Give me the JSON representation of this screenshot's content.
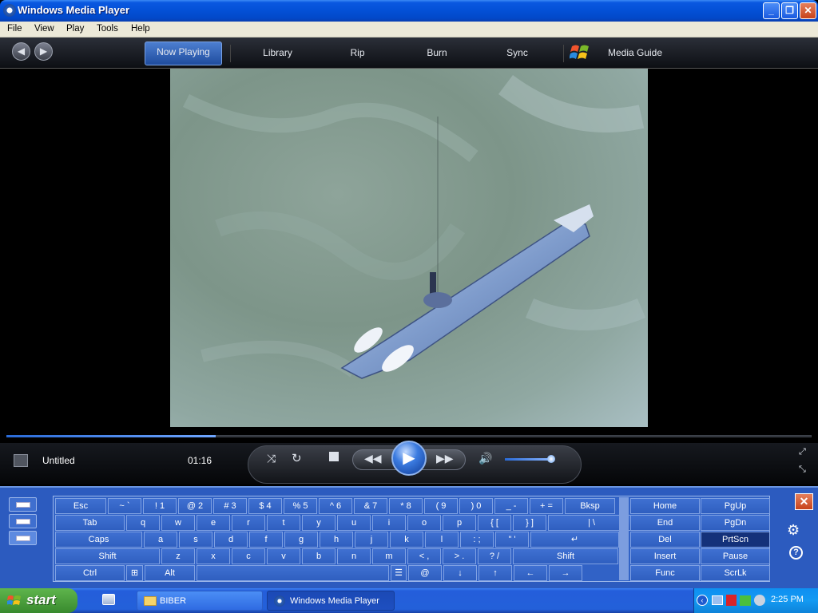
{
  "window": {
    "title": "Windows Media Player",
    "minimize_label": "_",
    "maximize_label": "❐",
    "close_label": "✕"
  },
  "menu": [
    "File",
    "View",
    "Play",
    "Tools",
    "Help"
  ],
  "tabs": [
    {
      "label": "Now Playing",
      "active": true
    },
    {
      "label": "Library"
    },
    {
      "label": "Rip"
    },
    {
      "label": "Burn"
    },
    {
      "label": "Sync"
    },
    {
      "label": "Media Guide"
    }
  ],
  "player": {
    "track_title": "Untitled",
    "time": "01:16",
    "seek_progress": 0.26,
    "volume_level": 0.93,
    "icons": [
      "shuffle-icon",
      "repeat-icon",
      "stop-icon",
      "previous-icon",
      "play-icon",
      "next-icon",
      "mute-icon",
      "fullscreen-icon",
      "compact-mode-icon"
    ]
  },
  "keyboard": {
    "row1": [
      "Esc",
      "~ `",
      "! 1",
      "@ 2",
      "# 3",
      "$ 4",
      "% 5",
      "^ 6",
      "& 7",
      "* 8",
      "( 9",
      ") 0",
      "_ -",
      "+ =",
      "Bksp"
    ],
    "row2": [
      "Tab",
      "q",
      "w",
      "e",
      "r",
      "t",
      "y",
      "u",
      "i",
      "o",
      "p",
      "{ [",
      "} ]",
      "| \\"
    ],
    "row3": [
      "Caps",
      "a",
      "s",
      "d",
      "f",
      "g",
      "h",
      "j",
      "k",
      "l",
      ": ;",
      "\" '",
      "↵"
    ],
    "row4": [
      "Shift",
      "z",
      "x",
      "c",
      "v",
      "b",
      "n",
      "m",
      "< ,",
      "> .",
      "? /",
      "Shift"
    ],
    "row5": [
      "Ctrl",
      "⊞",
      "Alt",
      "",
      "☰",
      "@",
      "↓",
      "↑",
      "←",
      "→"
    ],
    "nav": [
      [
        "Home",
        "PgUp"
      ],
      [
        "End",
        "PgDn"
      ],
      [
        "Del",
        "PrtScn"
      ],
      [
        "Insert",
        "Pause"
      ],
      [
        "Func",
        "ScrLk"
      ]
    ],
    "close_label": "✕",
    "settings_label": "⚙",
    "help_label": "?"
  },
  "taskbar": {
    "start_label": "start",
    "items": [
      {
        "label": ""
      },
      {
        "label": "BIBER"
      },
      {
        "label": "Windows Media Player",
        "active": true
      }
    ],
    "clock": "2:25 PM"
  }
}
